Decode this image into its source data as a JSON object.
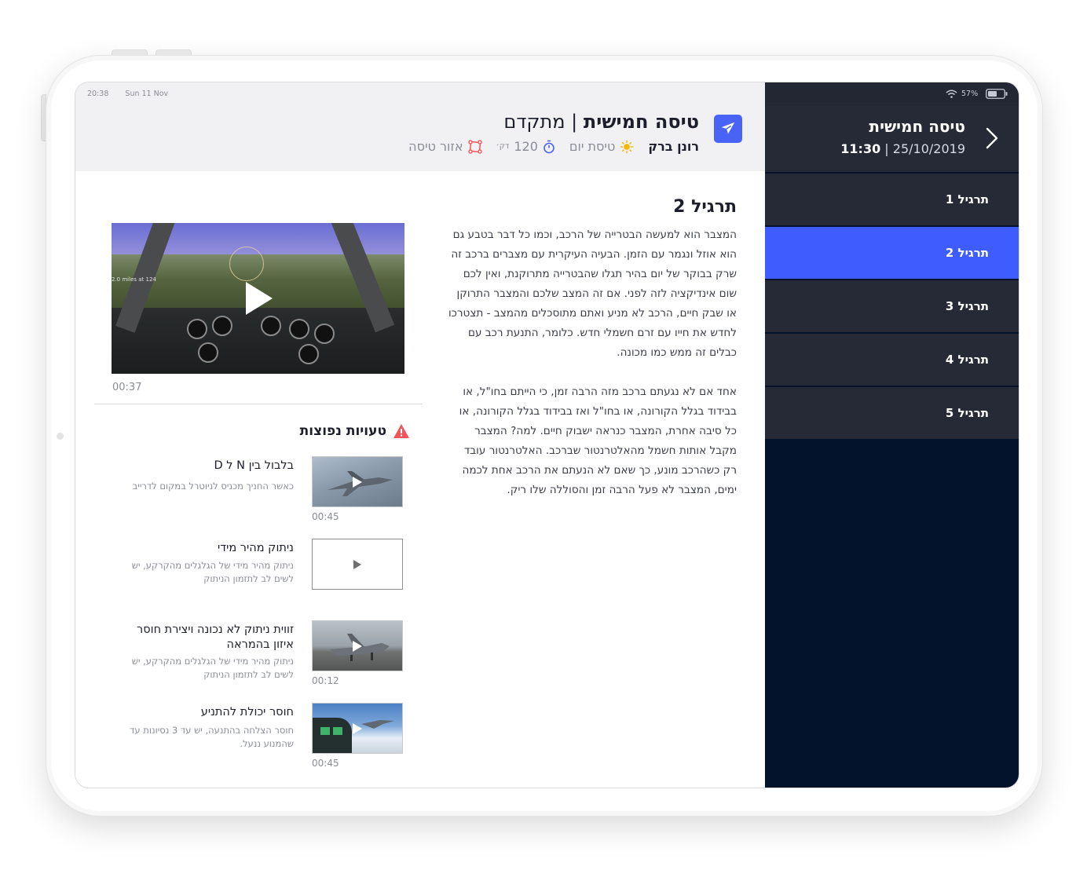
{
  "status": {
    "time": "20:38",
    "date": "Sun 11 Nov",
    "battery": "57%"
  },
  "header": {
    "title_bold": "טיסה חמישית",
    "title_rest": " | מתקדם",
    "pilot": "רונן ברק",
    "flight_type": "טיסת יום",
    "duration_value": "120",
    "duration_unit": "דק׳",
    "zone": "אזור טיסה"
  },
  "exercise": {
    "title": "תרגיל 2",
    "paragraph1": "המצבר הוא למעשה הבטרייה של הרכב, וכמו כל דבר בטבע גם הוא אוזל ונגמר עם הזמן. הבעיה העיקרית עם מצברים ברכב זה שרק בבוקר של יום בהיר תגלו שהבטרייה מתרוקנת, ואין לכם שום אינדיקציה לזה לפני. אם זה המצב שלכם והמצבר התרוקן או שבק חיים, הרכב לא מניע ואתם מתוסכלים מהמצב - תצטרכו לחדש את חייו עם זרם חשמלי חדש. כלומר, התנעת רכב עם כבלים זה ממש כמו מכונה.",
    "paragraph2": "אחד אם לא נגעתם ברכב מזה הרבה זמן, כי הייתם בחו\"ל, או בבידוד בגלל הקורונה, או בחו\"ל ואז בבידוד בגלל הקורונה, או כל סיבה אחרת, המצבר כנראה ישבוק חיים. למה? המצבר מקבל אותות חשמל מהאלטרנטור שברכב. האלטרנטור עובד רק כשהרכב מונע, כך שאם לא הנעתם את הרכב אחת לכמה ימים, המצבר לא פעל הרבה זמן והסוללה שלו ריק.",
    "video_time": "00:37",
    "video_overlay": "2.0 miles at 124"
  },
  "errors": {
    "title": "טעויות נפוצות",
    "items": [
      {
        "title": "בלבול בין N ל D",
        "desc": "כאשר החניך מכניס לניוטרל במקום לדרייב",
        "time": "00:45"
      },
      {
        "title": "ניתוק מהיר מידי",
        "desc": "ניתוק מהיר מידי של הגלגלים מהקרקע, יש לשים לב לתזמון הניתוק",
        "time": ""
      },
      {
        "title": "זווית ניתוק לא נכונה ויצירת חוסר איזון בהמראה",
        "desc": "ניתוק מהיר מידי של הגלגלים מהקרקע, יש לשים לב לתזמון הניתוק",
        "time": "00:12"
      },
      {
        "title": "חוסר יכולת להתניע",
        "desc": "חוסר הצלחה בהתנעה, יש עד 3 נסיונות עד שהמנוע ננעל.",
        "time": "00:45"
      }
    ]
  },
  "sidebar": {
    "title": "טיסה חמישית",
    "time": "11:30",
    "date": "25/10/2019",
    "exercises": [
      "תרגיל 1",
      "תרגיל 2",
      "תרגיל 3",
      "תרגיל 4",
      "תרגיל 5"
    ],
    "active_index": 1
  },
  "colors": {
    "accent": "#3f5cff",
    "sidebar_bg": "#02132b",
    "sidebar_item": "#262a37",
    "warning": "#f2545b"
  }
}
